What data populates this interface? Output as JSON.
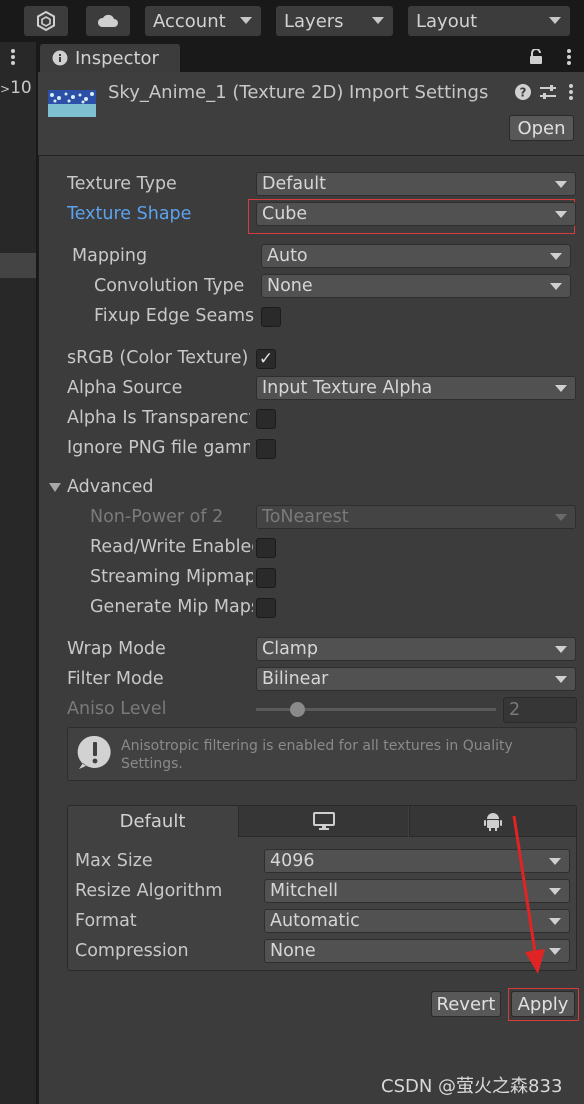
{
  "toolbar": {
    "account_label": "Account",
    "layers_label": "Layers",
    "layout_label": "Layout"
  },
  "left_strip": {
    "counter": "10"
  },
  "inspector": {
    "tab_label": "Inspector",
    "title": "Sky_Anime_1 (Texture 2D) Import Settings",
    "open_label": "Open"
  },
  "fields": {
    "texture_type": {
      "label": "Texture Type",
      "value": "Default"
    },
    "texture_shape": {
      "label": "Texture Shape",
      "value": "Cube"
    },
    "mapping": {
      "label": "Mapping",
      "value": "Auto"
    },
    "convolution_type": {
      "label": "Convolution Type",
      "value": "None"
    },
    "fixup_edge_seams": {
      "label": "Fixup Edge Seams"
    },
    "srgb": {
      "label": "sRGB (Color Texture)",
      "check": "✓"
    },
    "alpha_source": {
      "label": "Alpha Source",
      "value": "Input Texture Alpha"
    },
    "alpha_is_transparency": {
      "label": "Alpha Is Transparency"
    },
    "ignore_png_gamma": {
      "label": "Ignore PNG file gamma"
    },
    "advanced": {
      "label": "Advanced"
    },
    "non_power_of_2": {
      "label": "Non-Power of 2",
      "value": "ToNearest"
    },
    "read_write": {
      "label": "Read/Write Enabled"
    },
    "streaming_mipmaps": {
      "label": "Streaming Mipmaps"
    },
    "generate_mip_maps": {
      "label": "Generate Mip Maps"
    },
    "wrap_mode": {
      "label": "Wrap Mode",
      "value": "Clamp"
    },
    "filter_mode": {
      "label": "Filter Mode",
      "value": "Bilinear"
    },
    "aniso_level": {
      "label": "Aniso Level",
      "value": "2",
      "slider_fraction": 0.15
    }
  },
  "info_box": {
    "text": "Anisotropic filtering is enabled for all textures in Quality Settings."
  },
  "platform": {
    "tabs": {
      "default_label": "Default"
    },
    "max_size": {
      "label": "Max Size",
      "value": "4096"
    },
    "resize_algorithm": {
      "label": "Resize Algorithm",
      "value": "Mitchell"
    },
    "format": {
      "label": "Format",
      "value": "Automatic"
    },
    "compression": {
      "label": "Compression",
      "value": "None"
    }
  },
  "actions": {
    "revert_label": "Revert",
    "apply_label": "Apply"
  },
  "watermark": "CSDN @萤火之森833",
  "colors": {
    "highlight_border": "#d83b3b",
    "label_blue": "#5da2ef",
    "arrow_red": "#e02424"
  }
}
